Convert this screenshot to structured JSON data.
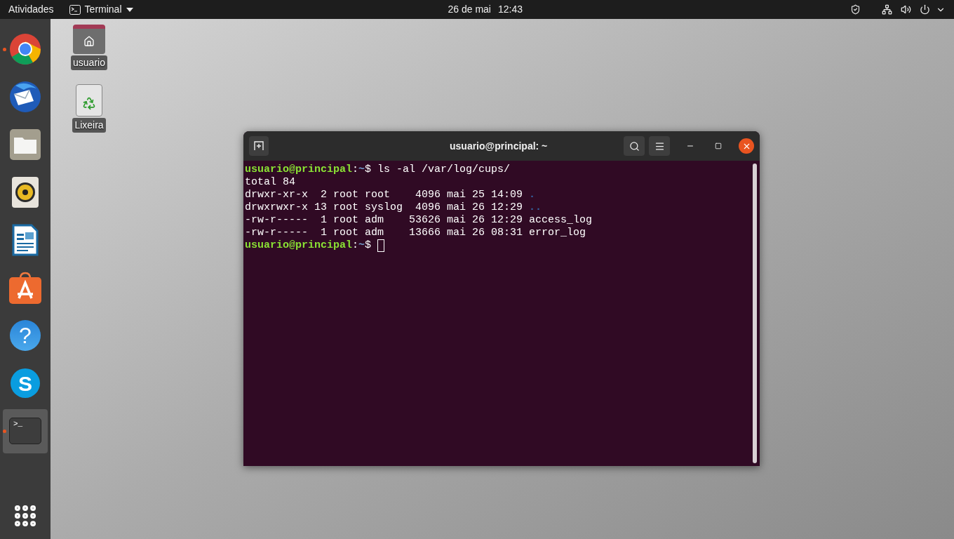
{
  "top_bar": {
    "activities": "Atividades",
    "app_menu": "Terminal",
    "date": "26 de mai",
    "time": "12:43"
  },
  "dock": [
    {
      "kind": "chrome",
      "running": true,
      "selected": false
    },
    {
      "kind": "mail",
      "running": false,
      "selected": false
    },
    {
      "kind": "files",
      "running": false,
      "selected": false
    },
    {
      "kind": "music",
      "running": false,
      "selected": false
    },
    {
      "kind": "writer",
      "running": false,
      "selected": false
    },
    {
      "kind": "store",
      "running": false,
      "selected": false
    },
    {
      "kind": "help",
      "glyph": "?",
      "running": false,
      "selected": false
    },
    {
      "kind": "skype",
      "glyph": "S",
      "running": false,
      "selected": false
    },
    {
      "kind": "terminal",
      "glyph": ">_",
      "running": true,
      "selected": true
    }
  ],
  "desktop_icons": [
    {
      "kind": "home",
      "label": "usuario"
    },
    {
      "kind": "trash",
      "label": "Lixeira"
    }
  ],
  "terminal": {
    "title": "usuario@principal: ~",
    "lines": [
      {
        "kind": "prompt",
        "user": "usuario@principal",
        "sep": ":",
        "path": "~",
        "symbol": "$",
        "command": "ls -al /var/log/cups/",
        "cursor": false
      },
      {
        "kind": "plain",
        "text": "total 84"
      },
      {
        "kind": "entry",
        "info": "drwxr-xr-x  2 root root    4096 mai 25 14:09",
        "name": ".",
        "is_dir": true
      },
      {
        "kind": "entry",
        "info": "drwxrwxr-x 13 root syslog  4096 mai 26 12:29",
        "name": "..",
        "is_dir": true
      },
      {
        "kind": "entry",
        "info": "-rw-r-----  1 root adm    53626 mai 26 12:29",
        "name": "access_log",
        "is_dir": false
      },
      {
        "kind": "entry",
        "info": "-rw-r-----  1 root adm    13666 mai 26 08:31",
        "name": "error_log",
        "is_dir": false
      },
      {
        "kind": "prompt",
        "user": "usuario@principal",
        "sep": ":",
        "path": "~",
        "symbol": "$",
        "cursor": true
      }
    ]
  }
}
